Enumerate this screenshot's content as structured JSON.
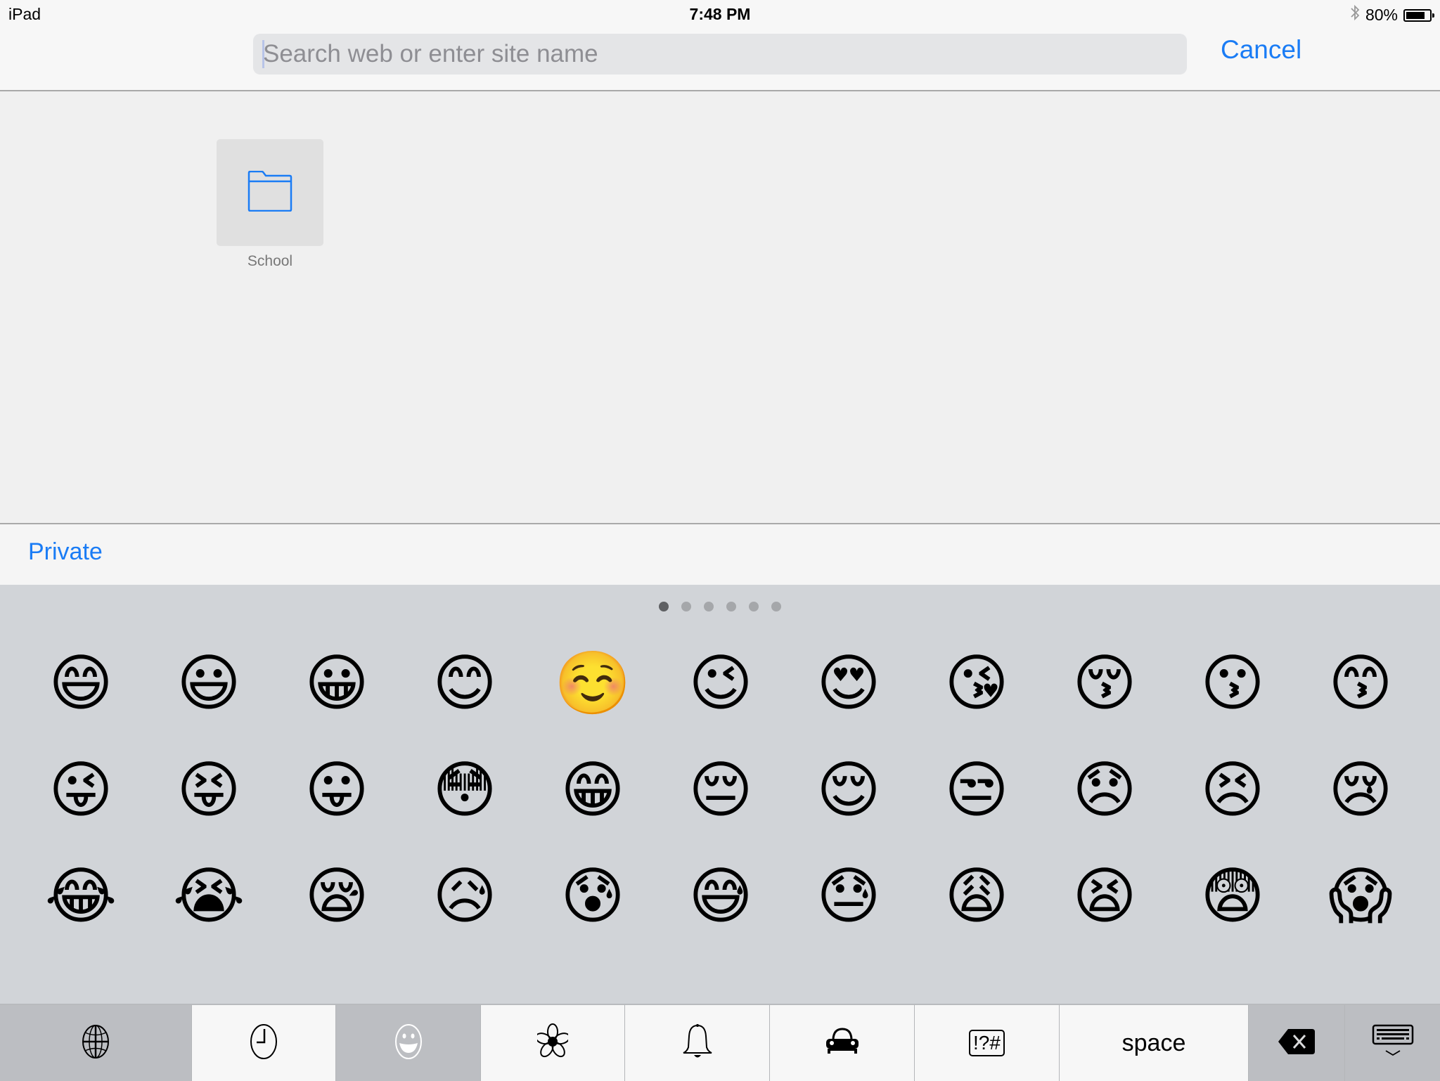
{
  "status_bar": {
    "device": "iPad",
    "time": "7:48 PM",
    "battery_percent_label": "80%",
    "battery_level": 0.8,
    "icons": [
      "bluetooth-icon",
      "battery-icon"
    ]
  },
  "header": {
    "search": {
      "value": "",
      "placeholder": "Search web or enter site name"
    },
    "cancel_label": "Cancel"
  },
  "favorites": [
    {
      "label": "School",
      "icon": "folder-icon"
    }
  ],
  "private_label": "Private",
  "colors": {
    "accent": "#1a7cf5",
    "keyboard_bg": "#d1d4d8",
    "folder_tile": "#e0e0e0"
  },
  "keyboard": {
    "page_count": 6,
    "active_page": 1,
    "emoji_rows": [
      [
        "😄",
        "😃",
        "😀",
        "😊",
        "☺️",
        "😉",
        "😍",
        "😘",
        "😚",
        "😗",
        "😙"
      ],
      [
        "😜",
        "😝",
        "😛",
        "😳",
        "😁",
        "😔",
        "😌",
        "😒",
        "😞",
        "😣",
        "😢"
      ],
      [
        "😂",
        "😭",
        "😪",
        "😥",
        "😰",
        "😅",
        "😓",
        "😩",
        "😫",
        "😨",
        "😱"
      ]
    ],
    "bottom_keys": [
      {
        "name": "globe-key",
        "icon": "globe-icon",
        "style": "dark"
      },
      {
        "name": "recent-key",
        "icon": "clock-icon",
        "style": "light"
      },
      {
        "name": "smileys-key",
        "icon": "smiley-icon",
        "style": "dark"
      },
      {
        "name": "nature-key",
        "icon": "flower-icon",
        "style": "light"
      },
      {
        "name": "objects-key",
        "icon": "bell-icon",
        "style": "light"
      },
      {
        "name": "places-key",
        "icon": "car-icon",
        "style": "light"
      },
      {
        "name": "symbols-key",
        "icon": "symbols-icon",
        "label": "!?#",
        "style": "light"
      },
      {
        "name": "space-key",
        "label": "space",
        "style": "light"
      },
      {
        "name": "delete-key",
        "icon": "backspace-icon",
        "style": "dark"
      },
      {
        "name": "dismiss-keyboard-key",
        "icon": "keyboard-dismiss-icon",
        "style": "dark"
      }
    ]
  }
}
